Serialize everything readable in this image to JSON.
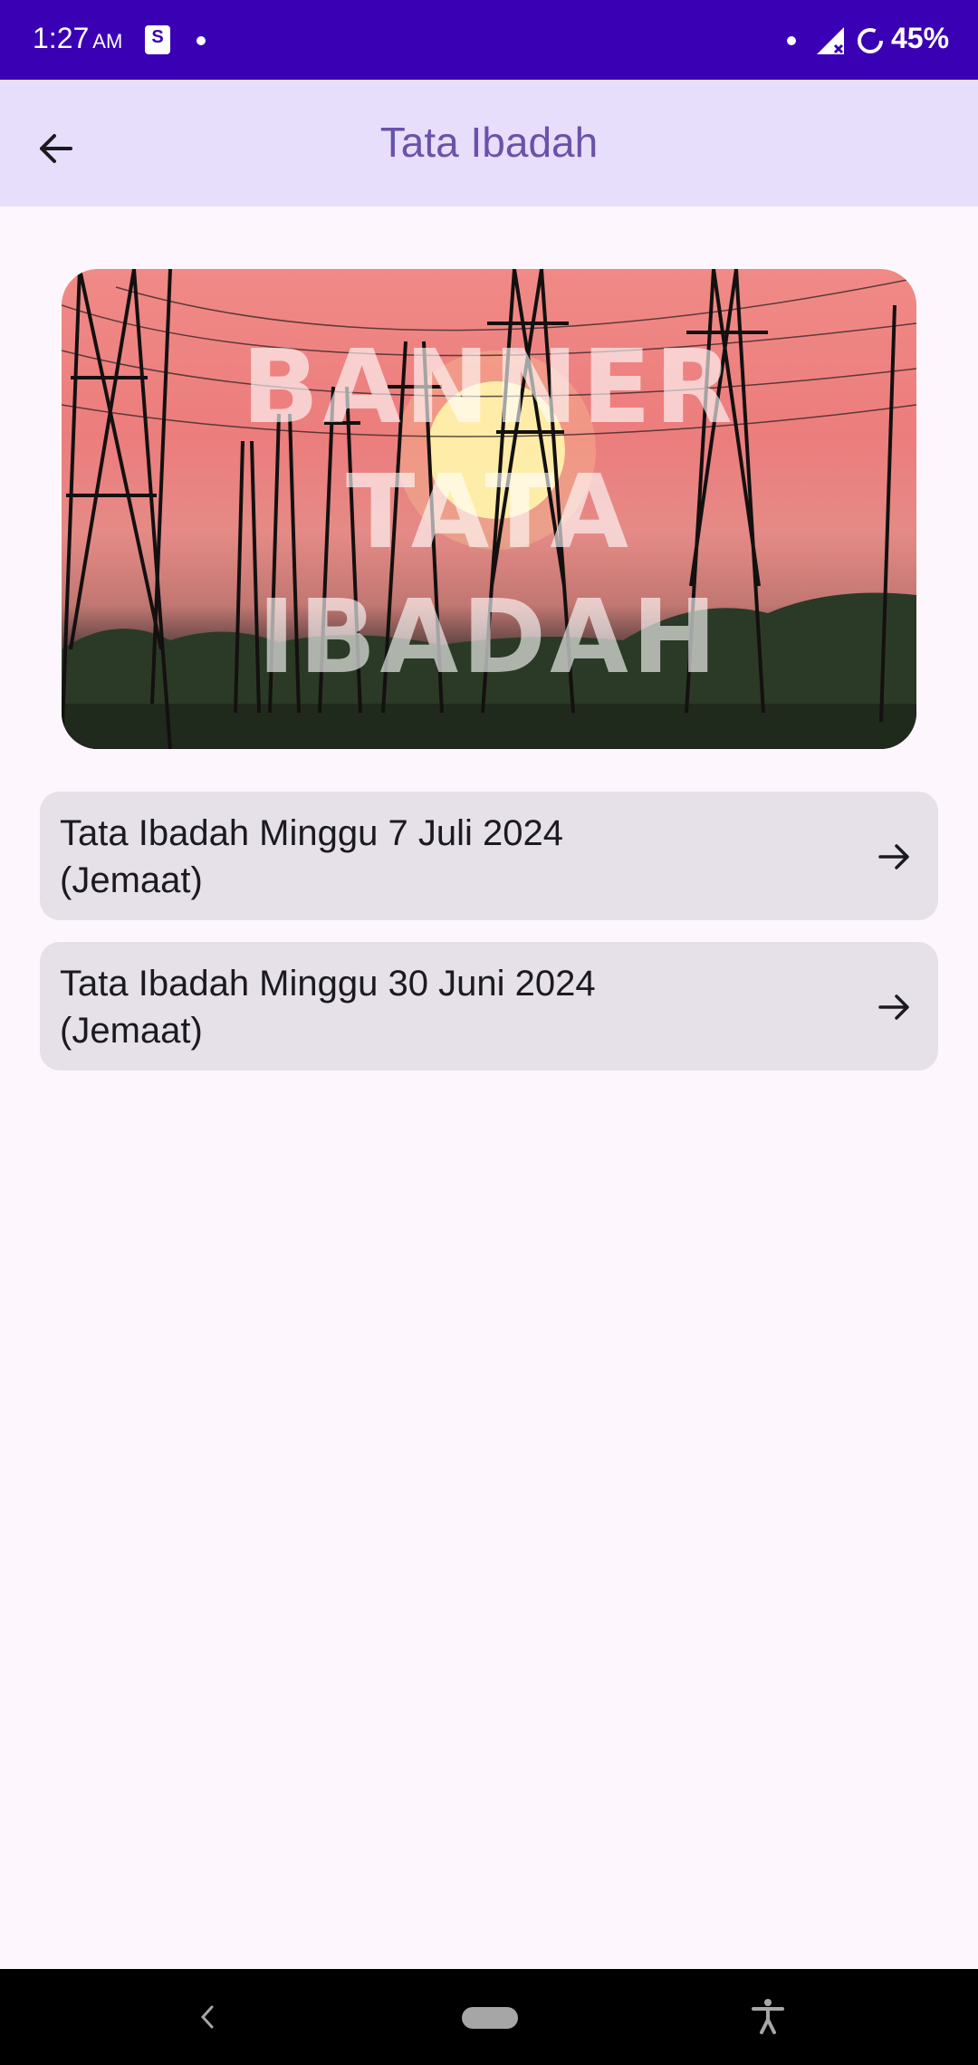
{
  "status_bar": {
    "time": "1:27",
    "ampm": "AM",
    "shop_icon_letter": "S",
    "battery_percent": "45%"
  },
  "app_bar": {
    "title": "Tata Ibadah",
    "back_icon": "arrow-back-icon"
  },
  "banner": {
    "text_line1": "BANNER",
    "text_line2": "TATA",
    "text_line3": "IBADAH"
  },
  "list": {
    "items": [
      {
        "line1": "Tata Ibadah Minggu 7 Juli 2024",
        "line2": "(Jemaat)",
        "icon": "arrow-forward-icon"
      },
      {
        "line1": "Tata Ibadah Minggu 30 Juni 2024",
        "line2": "(Jemaat)",
        "icon": "arrow-forward-icon"
      }
    ]
  },
  "colors": {
    "status_bar": "#3a00b3",
    "app_bar": "#e7defc",
    "title": "#6a52a9",
    "background": "#fdf7fd",
    "list_item": "#e6e0e8"
  }
}
